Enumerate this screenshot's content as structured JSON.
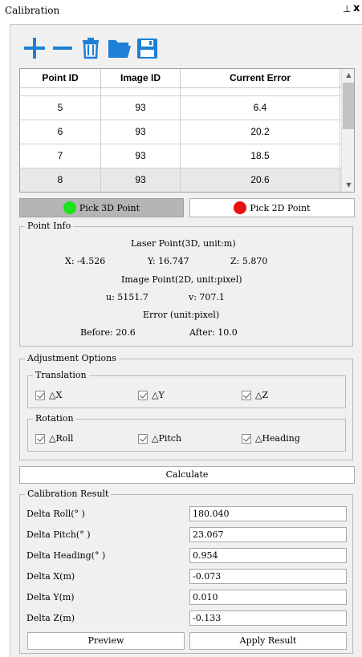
{
  "window": {
    "title": "Calibration",
    "pin_glyph": "ᵖ",
    "close_glyph": "x"
  },
  "toolbar": {
    "icons": [
      "plus-icon",
      "minus-icon",
      "trash-icon",
      "folder-open-icon",
      "save-icon"
    ],
    "accent": "#1e7fd6"
  },
  "table": {
    "headers": [
      "Point ID",
      "Image ID",
      "Current Error"
    ],
    "rows": [
      {
        "point": "5",
        "image": "93",
        "error": "6.4"
      },
      {
        "point": "6",
        "image": "93",
        "error": "20.2"
      },
      {
        "point": "7",
        "image": "93",
        "error": "18.5"
      },
      {
        "point": "8",
        "image": "93",
        "error": "20.6"
      }
    ],
    "selected_row": 3
  },
  "pick": {
    "pick3d_label": "Pick 3D Point",
    "pick2d_label": "Pick 2D Point",
    "green": "#19e619",
    "red": "#e81010"
  },
  "point_info": {
    "title": "Point Info",
    "laser_header": "Laser Point(3D, unit:m)",
    "x": "X: -4.526",
    "y": "Y: 16.747",
    "z": "Z: 5.870",
    "image_header": "Image Point(2D, unit:pixel)",
    "u": "u: 5151.7",
    "v": "v: 707.1",
    "error_header": "Error (unit:pixel)",
    "before": "Before: 20.6",
    "after": "After: 10.0"
  },
  "adjustment": {
    "title": "Adjustment Options",
    "translation_title": "Translation",
    "translation": [
      "△X",
      "△Y",
      "△Z"
    ],
    "rotation_title": "Rotation",
    "rotation": [
      "△Roll",
      "△Pitch",
      "△Heading"
    ]
  },
  "calculate_label": "Calculate",
  "result": {
    "title": "Calibration Result",
    "rows": [
      {
        "label": "Delta Roll(° )",
        "value": "180.040"
      },
      {
        "label": "Delta Pitch(° )",
        "value": "23.067"
      },
      {
        "label": "Delta Heading(° )",
        "value": "0.954"
      },
      {
        "label": "Delta X(m)",
        "value": "-0.073"
      },
      {
        "label": "Delta Y(m)",
        "value": "0.010"
      },
      {
        "label": "Delta Z(m)",
        "value": "-0.133"
      }
    ],
    "preview_label": "Preview",
    "apply_label": "Apply Result"
  }
}
